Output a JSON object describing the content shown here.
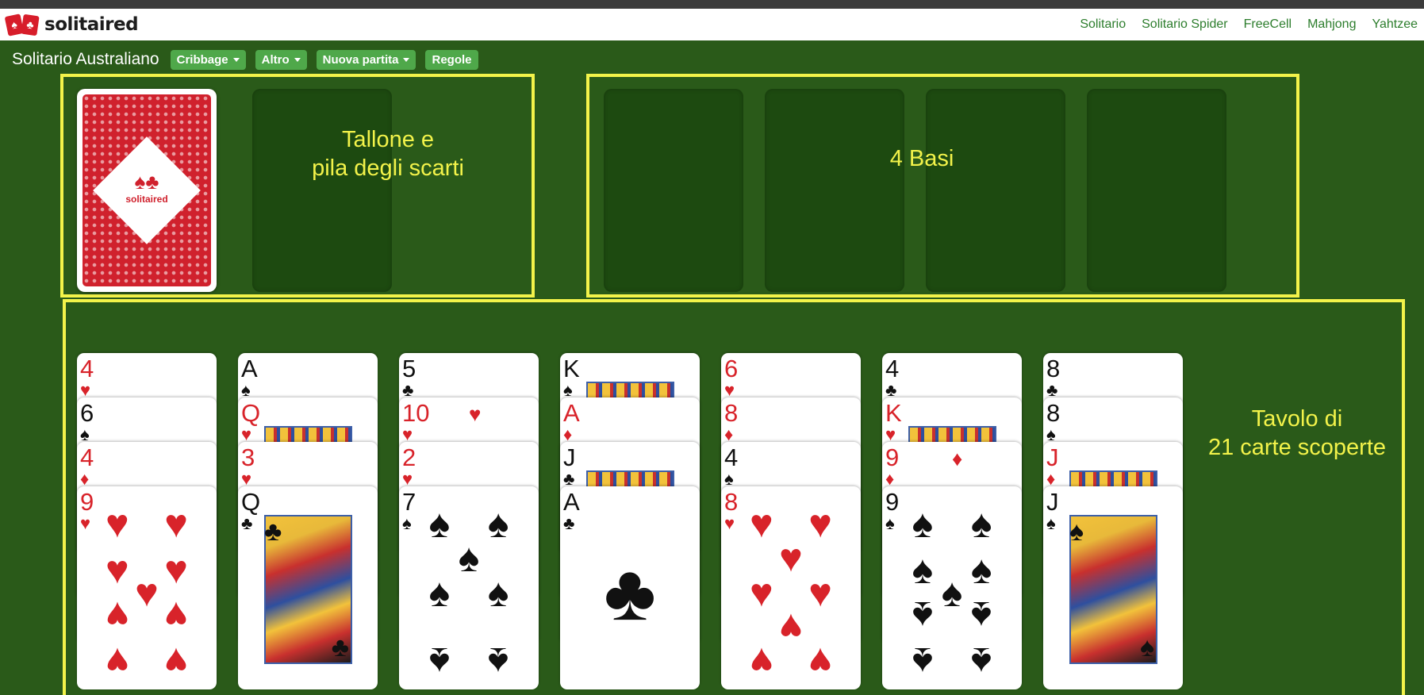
{
  "navbar": {
    "brand": "solitaired",
    "logo_suits": [
      "♠",
      "♣"
    ],
    "links": [
      "Solitario",
      "Solitario Spider",
      "FreeCell",
      "Mahjong",
      "Yahtzee"
    ]
  },
  "toolbar": {
    "title": "Solitario Australiano",
    "buttons": [
      {
        "label": "Cribbage",
        "dropdown": true
      },
      {
        "label": "Altro",
        "dropdown": true
      },
      {
        "label": "Nuova partita",
        "dropdown": true
      },
      {
        "label": "Regole",
        "dropdown": false
      }
    ]
  },
  "labels": {
    "stock_waste": "Tallone e\npila degli scarti",
    "foundations": "4 Basi",
    "tableau": "Tavolo di\n21 carte scoperte"
  },
  "stock": {
    "card_back_brand": "solitaired",
    "card_back_suits": "♠♣"
  },
  "colors": {
    "felt": "#2a5a19",
    "slot": "#1d4a10",
    "annotation_yellow": "#f3f34a",
    "menu_button": "#4fa84a",
    "nav_link": "#2c7d2c",
    "card_red": "#d8232a",
    "card_back": "#d0212d"
  },
  "tableau": [
    [
      {
        "rank": "4",
        "suit": "♥"
      },
      {
        "rank": "6",
        "suit": "♠"
      },
      {
        "rank": "4",
        "suit": "♦"
      },
      {
        "rank": "9",
        "suit": "♥"
      }
    ],
    [
      {
        "rank": "A",
        "suit": "♠"
      },
      {
        "rank": "Q",
        "suit": "♥"
      },
      {
        "rank": "3",
        "suit": "♥"
      },
      {
        "rank": "Q",
        "suit": "♣"
      }
    ],
    [
      {
        "rank": "5",
        "suit": "♣"
      },
      {
        "rank": "10",
        "suit": "♥"
      },
      {
        "rank": "2",
        "suit": "♥"
      },
      {
        "rank": "7",
        "suit": "♠"
      }
    ],
    [
      {
        "rank": "K",
        "suit": "♠"
      },
      {
        "rank": "A",
        "suit": "♦"
      },
      {
        "rank": "J",
        "suit": "♣"
      },
      {
        "rank": "A",
        "suit": "♣"
      }
    ],
    [
      {
        "rank": "6",
        "suit": "♥"
      },
      {
        "rank": "8",
        "suit": "♦"
      },
      {
        "rank": "4",
        "suit": "♠"
      },
      {
        "rank": "8",
        "suit": "♥"
      }
    ],
    [
      {
        "rank": "4",
        "suit": "♣"
      },
      {
        "rank": "K",
        "suit": "♥"
      },
      {
        "rank": "9",
        "suit": "♦"
      },
      {
        "rank": "9",
        "suit": "♠"
      }
    ],
    [
      {
        "rank": "8",
        "suit": "♣"
      },
      {
        "rank": "8",
        "suit": "♠"
      },
      {
        "rank": "J",
        "suit": "♦"
      },
      {
        "rank": "J",
        "suit": "♠"
      }
    ]
  ]
}
